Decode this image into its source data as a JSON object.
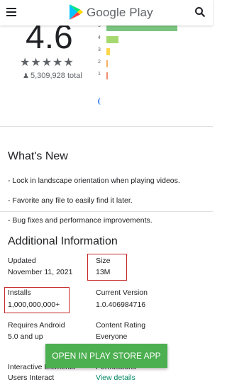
{
  "header": {
    "brand": "Google Play"
  },
  "rating": {
    "score": "4.6",
    "stars": "★★★★★",
    "reviews_count": "5,309,928 total"
  },
  "histogram": [
    {
      "label": "5",
      "fraction": 0.82,
      "color": "#7bc47f"
    },
    {
      "label": "4",
      "fraction": 0.14,
      "color": "#a5d86e"
    },
    {
      "label": "3",
      "fraction": 0.04,
      "color": "#fbd648"
    },
    {
      "label": "2",
      "fraction": 0.01,
      "color": "#f6ae5d"
    },
    {
      "label": "1",
      "fraction": 0.02,
      "color": "#f38c6b"
    }
  ],
  "whats_new": {
    "title": "What's New",
    "lines": [
      "- Lock in landscape orientation when playing videos.",
      "- Favorite any file to easily find it later.",
      "- Bug fixes and performance improvements."
    ]
  },
  "additional_info": {
    "title": "Additional Information",
    "updated_label": "Updated",
    "updated_value": "November 11, 2021",
    "size_label": "Size",
    "size_value": "13M",
    "installs_label": "Installs",
    "installs_value": "1,000,000,000+",
    "version_label": "Current Version",
    "version_value": "1.0.406984716",
    "android_label": "Requires Android",
    "android_value": "5.0 and up",
    "content_rating_label": "Content Rating",
    "content_rating_value": "Everyone",
    "interactive_label": "Interactive Elements",
    "interactive_value": "Users Interact",
    "permissions_label": "Permissions",
    "permissions_value": "View details"
  },
  "cta": {
    "label": "OPEN IN PLAY STORE APP"
  },
  "highlight_color": "#c62828"
}
